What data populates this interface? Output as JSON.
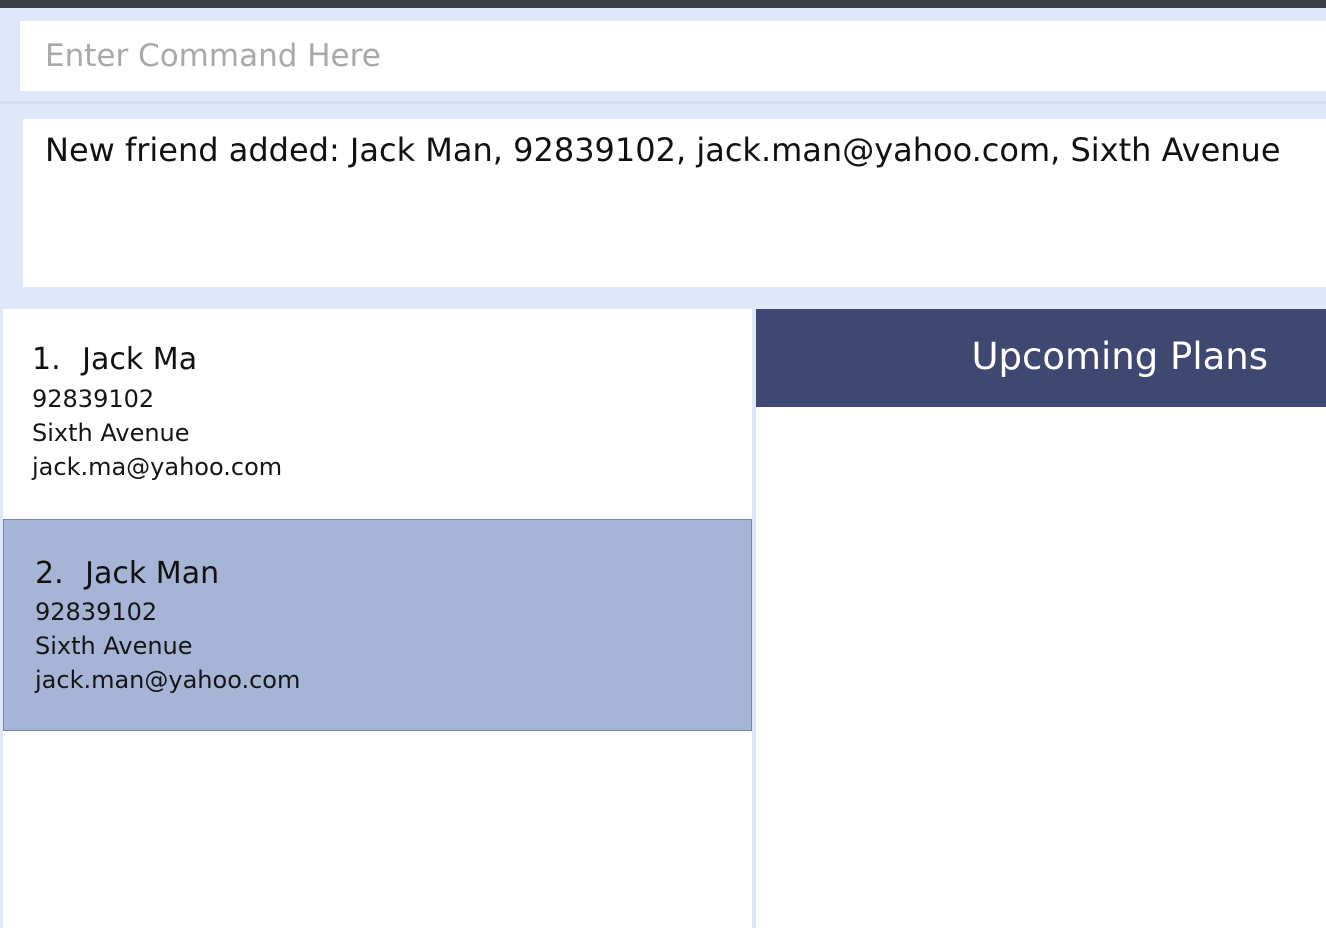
{
  "command": {
    "placeholder": "Enter Command Here",
    "value": ""
  },
  "result": {
    "message": "New friend added: Jack Man, 92839102, jack.man@yahoo.com, Sixth Avenue"
  },
  "friends": [
    {
      "index": "1.",
      "name": "Jack Ma",
      "phone": "92839102",
      "address": "Sixth Avenue",
      "email": "jack.ma@yahoo.com",
      "selected": false
    },
    {
      "index": "2.",
      "name": "Jack Man",
      "phone": "92839102",
      "address": "Sixth Avenue",
      "email": "jack.man@yahoo.com",
      "selected": true
    }
  ],
  "plans": {
    "title": "Upcoming Plans"
  },
  "colors": {
    "background": "#dfe8fb",
    "selected_card": "#a6b5d6",
    "plans_header": "#3f4870"
  }
}
